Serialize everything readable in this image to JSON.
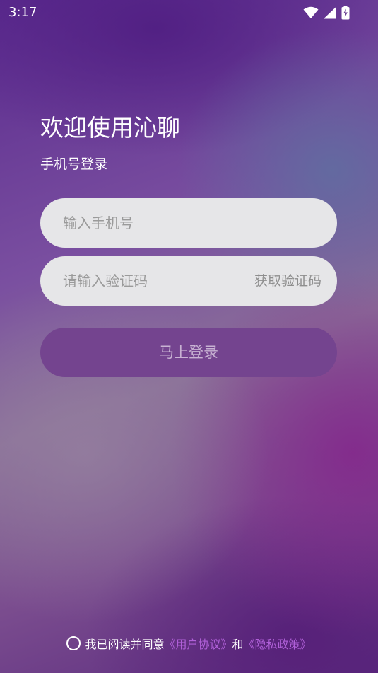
{
  "status_bar": {
    "time": "3:17",
    "icons": [
      "wifi-icon",
      "cellular-signal-icon",
      "battery-charging-icon"
    ]
  },
  "header": {
    "title": "欢迎使用沁聊",
    "subtitle": "手机号登录"
  },
  "form": {
    "phone_placeholder": "输入手机号",
    "phone_value": "",
    "code_placeholder": "请输入验证码",
    "code_value": "",
    "get_code_label": "获取验证码",
    "login_label": "马上登录"
  },
  "agreement": {
    "checked": false,
    "prefix": "我已阅读并同意",
    "user_agreement": "《用户协议》",
    "and": "和",
    "privacy_policy": "《隐私政策》"
  },
  "colors": {
    "accent_link": "#b060d8",
    "login_button": "#74448f",
    "input_background": "#e6e6e8"
  }
}
